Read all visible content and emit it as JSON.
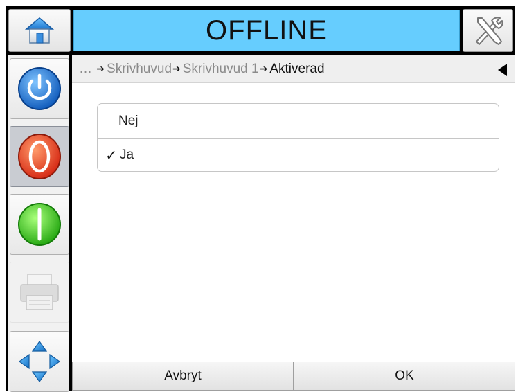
{
  "header": {
    "status": "OFFLINE",
    "home_icon": "home-icon",
    "tools_icon": "tools-icon",
    "status_color": "#66cdfe"
  },
  "sidebar": {
    "items": [
      {
        "name": "power-icon",
        "color": "#1b6fd6"
      },
      {
        "name": "stop-icon",
        "color": "#e83a1a"
      },
      {
        "name": "start-icon",
        "color": "#35c81a"
      },
      {
        "name": "printer-icon",
        "color": "#c6c6c6"
      },
      {
        "name": "navigation-icon",
        "color": "#2a8fd8"
      }
    ]
  },
  "breadcrumb": {
    "ellipsis": "…",
    "items": [
      "Skrivhuvud",
      "Skrivhuvud 1"
    ],
    "current": "Aktiverad"
  },
  "options": [
    {
      "label": "Nej",
      "checked": false
    },
    {
      "label": "Ja",
      "checked": true,
      "check_mark": "✓"
    }
  ],
  "footer": {
    "cancel_label": "Avbryt",
    "ok_label": "OK"
  }
}
